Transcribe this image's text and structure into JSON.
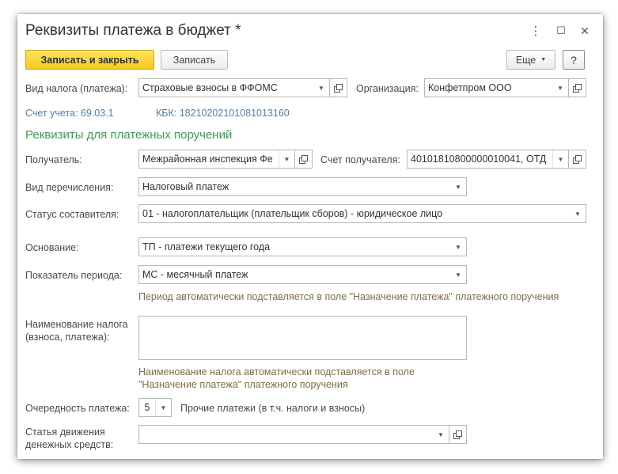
{
  "window": {
    "title": "Реквизиты платежа в бюджет *",
    "more_glyph": "⋮",
    "maximize_glyph": "☐",
    "close_glyph": "✕"
  },
  "toolbar": {
    "save_close_label": "Записать и закрыть",
    "save_label": "Записать",
    "more_label": "Еще",
    "help_label": "?"
  },
  "header": {
    "tax_type_label": "Вид налога (платежа):",
    "tax_type_value": "Страховые взносы в ФФОМС",
    "organization_label": "Организация:",
    "organization_value": "Конфетпром ООО",
    "account_link": "Счет учета: 69.03.1",
    "kbk_link": "КБК: 18210202101081013160"
  },
  "section": {
    "title": "Реквизиты для платежных поручений"
  },
  "form": {
    "recipient_label": "Получатель:",
    "recipient_value": "Межрайонная инспекция Фе",
    "recipient_account_label": "Счет получателя:",
    "recipient_account_value": "40101810800000010041, ОТД",
    "transfer_type_label": "Вид перечисления:",
    "transfer_type_value": "Налоговый платеж",
    "status_label": "Статус составителя:",
    "status_value": "01 - налогоплательщик (плательщик сборов) - юридическое лицо",
    "basis_label": "Основание:",
    "basis_value": "ТП - платежи текущего года",
    "period_label": "Показатель периода:",
    "period_value": "МС - месячный платеж",
    "period_hint": "Период автоматически подставляется в поле \"Назначение платежа\" платежного поручения",
    "tax_name_label_1": "Наименование налога",
    "tax_name_label_2": "(взноса, платежа):",
    "tax_name_value": "",
    "tax_name_hint_1": "Наименование налога автоматически подставляется в поле",
    "tax_name_hint_2": "\"Назначение платежа\" платежного поручения",
    "priority_label": "Очередность платежа:",
    "priority_value": "5",
    "priority_desc": "Прочие платежи (в т.ч. налоги и взносы)",
    "cashflow_label_1": "Статья движения",
    "cashflow_label_2": "денежных средств:",
    "cashflow_value": ""
  },
  "icons": {
    "dropdown": "▼",
    "more_dropdown": "▼"
  }
}
